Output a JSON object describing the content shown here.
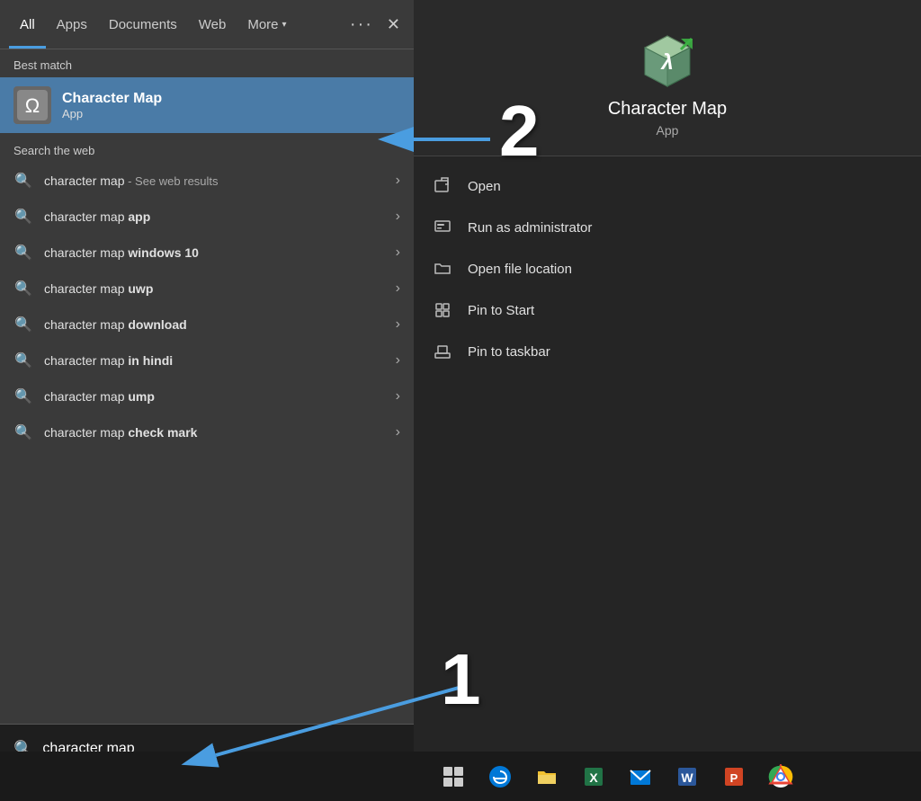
{
  "tabs": {
    "items": [
      {
        "label": "All",
        "active": true
      },
      {
        "label": "Apps",
        "active": false
      },
      {
        "label": "Documents",
        "active": false
      },
      {
        "label": "Web",
        "active": false
      },
      {
        "label": "More",
        "active": false
      }
    ]
  },
  "best_match": {
    "section_label": "Best match",
    "app_name": "Character Map",
    "app_type": "App"
  },
  "search_web": {
    "section_label": "Search the web",
    "items": [
      {
        "text_plain": "character map",
        "text_bold": "",
        "suffix": " - See web results"
      },
      {
        "text_plain": "character map ",
        "text_bold": "app",
        "suffix": ""
      },
      {
        "text_plain": "character map ",
        "text_bold": "windows 10",
        "suffix": ""
      },
      {
        "text_plain": "character map ",
        "text_bold": "uwp",
        "suffix": ""
      },
      {
        "text_plain": "character map ",
        "text_bold": "download",
        "suffix": ""
      },
      {
        "text_plain": "character map ",
        "text_bold": "in hindi",
        "suffix": ""
      },
      {
        "text_plain": "character map ",
        "text_bold": "ump",
        "suffix": ""
      },
      {
        "text_plain": "character map ",
        "text_bold": "check mark",
        "suffix": ""
      }
    ]
  },
  "search_input": {
    "value": "character map",
    "placeholder": "character map"
  },
  "right_panel": {
    "app_name": "Character Map",
    "app_type": "App",
    "actions": [
      {
        "label": "Open",
        "icon": "open"
      },
      {
        "label": "Run as administrator",
        "icon": "admin"
      },
      {
        "label": "Open file location",
        "icon": "folder"
      },
      {
        "label": "Pin to Start",
        "icon": "pin"
      },
      {
        "label": "Pin to taskbar",
        "icon": "pin-taskbar"
      }
    ]
  },
  "annotations": {
    "number1": "1",
    "number2": "2"
  },
  "taskbar": {
    "icons": [
      "⊞",
      "🌐",
      "📁",
      "📗",
      "✉",
      "W",
      "P",
      "🌐"
    ]
  }
}
